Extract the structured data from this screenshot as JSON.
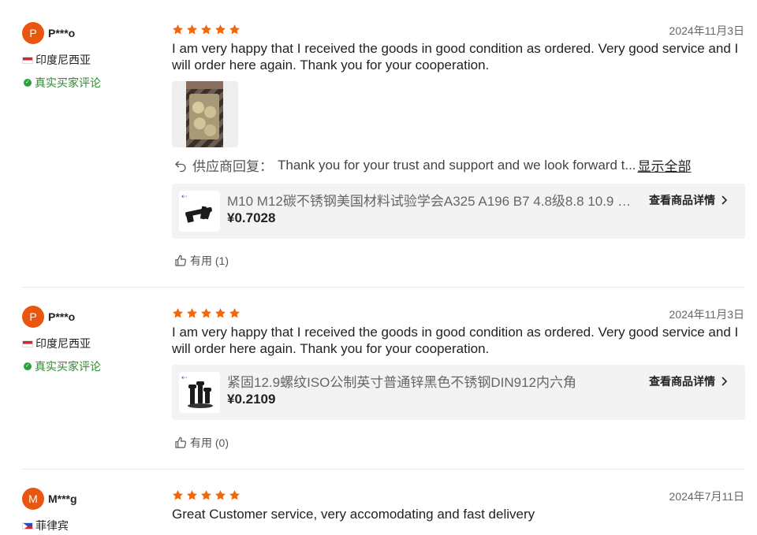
{
  "reviews": [
    {
      "avatar_letter": "P",
      "user": "P***o",
      "country": "印度尼西亚",
      "verified_label": "真实买家评论",
      "date": "2024年11月3日",
      "rating": 5,
      "text": "I am very happy that I received the goods in good condition as ordered. Very good service and I will order here again. Thank you for your cooperation.",
      "reply_label": "供应商回复：",
      "reply_text": "Thank you for your trust and support and we look forward t...",
      "show_all": "显示全部",
      "product_name": "M10 M12碳不锈钢美国材料试验学会A325 A196 B7 4.8级8.8 10.9 12...",
      "product_price": "¥0.7028",
      "product_detail": "查看商品详情",
      "helpful": "有用 (1)"
    },
    {
      "avatar_letter": "P",
      "user": "P***o",
      "country": "印度尼西亚",
      "verified_label": "真实买家评论",
      "date": "2024年11月3日",
      "rating": 5,
      "text": "I am very happy that I received the goods in good condition as ordered. Very good service and I will order here again. Thank you for your cooperation.",
      "product_name": "紧固12.9螺纹ISO公制英寸普通锌黑色不锈钢DIN912内六角",
      "product_price": "¥0.2109",
      "product_detail": "查看商品详情",
      "helpful": "有用 (0)"
    },
    {
      "avatar_letter": "M",
      "user": "M***g",
      "country": "菲律宾",
      "date": "2024年7月11日",
      "rating": 5,
      "text": "Great Customer service, very accomodating and fast delivery"
    }
  ],
  "colors": {
    "accent": "#f0670d",
    "avatar": "#e8560f",
    "verified": "#2e8b2e"
  },
  "icons": [
    "star-icon",
    "reply-icon",
    "thumbs-up-icon",
    "chevron-right-icon",
    "verified-icon",
    "flag-icon"
  ]
}
